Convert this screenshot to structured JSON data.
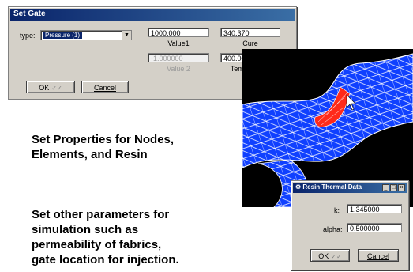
{
  "set_gate_dialog": {
    "title": "Set Gate",
    "type_label": "type:",
    "type_value": "Pressure (1)",
    "value1": "1000.000",
    "value1_label": "Value1",
    "value2": "-1.000000",
    "value2_label": "Value 2",
    "cure": "340.370",
    "cure_label": "Cure",
    "temperature": "400.000",
    "temperature_label": "Temperature",
    "ok_label": "OK",
    "cancel_label": "Cancel"
  },
  "slide": {
    "text1": [
      "Set Properties for Nodes,",
      "Elements, and Resin"
    ],
    "text2": [
      "Set other parameters for",
      "simulation such as",
      "permeability of fabrics,",
      "gate location for injection."
    ]
  },
  "resin_dialog": {
    "title": "Resin Thermal Data",
    "k_label": "k:",
    "k_value": "1.345000",
    "alpha_label": "alpha:",
    "alpha_value": "0.500000",
    "ok_label": "OK",
    "cancel_label": "Cancel"
  },
  "colors": {
    "mesh_fill": "#1040ff",
    "mesh_lines": "#ffffff",
    "gate_region": "#ff2a1a",
    "titlebar": "#0a246a"
  }
}
